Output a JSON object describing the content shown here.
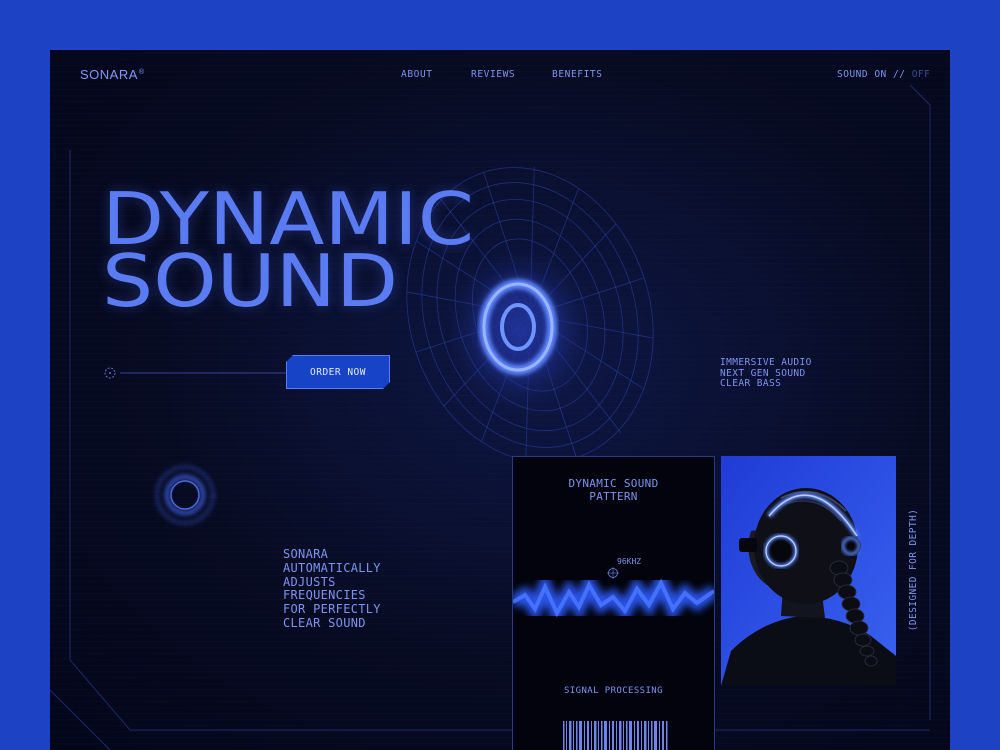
{
  "header": {
    "logo": "SONARA",
    "logo_mark": "®",
    "nav": [
      {
        "label": "ABOUT"
      },
      {
        "label": "REVIEWS"
      },
      {
        "label": "BENEFITS"
      }
    ],
    "sound": {
      "label": "SOUND ON",
      "sep": "//",
      "off": "OFF"
    }
  },
  "hero": {
    "line1": "DYNAMIC",
    "line2": "SOUND",
    "order_button": "ORDER NOW"
  },
  "features": [
    "IMMERSIVE AUDIO",
    "NEXT GEN SOUND",
    "CLEAR BASS"
  ],
  "description": [
    "SONARA",
    "AUTOMATICALLY",
    "ADJUSTS",
    "FREQUENCIES",
    "FOR PERFECTLY",
    "CLEAR SOUND"
  ],
  "card": {
    "title": [
      "DYNAMIC SOUND",
      "PATTERN"
    ],
    "frequency": "96KHZ",
    "signal": "SIGNAL PROCESSING"
  },
  "vertical_label": "(DESIGNED FOR DEPTH)",
  "colors": {
    "outer_background": "#1d43c4",
    "panel_background": "#070b22",
    "accent_text": "#7e93ef",
    "hero_text": "#5b7bf2",
    "button": "#1743c6"
  }
}
